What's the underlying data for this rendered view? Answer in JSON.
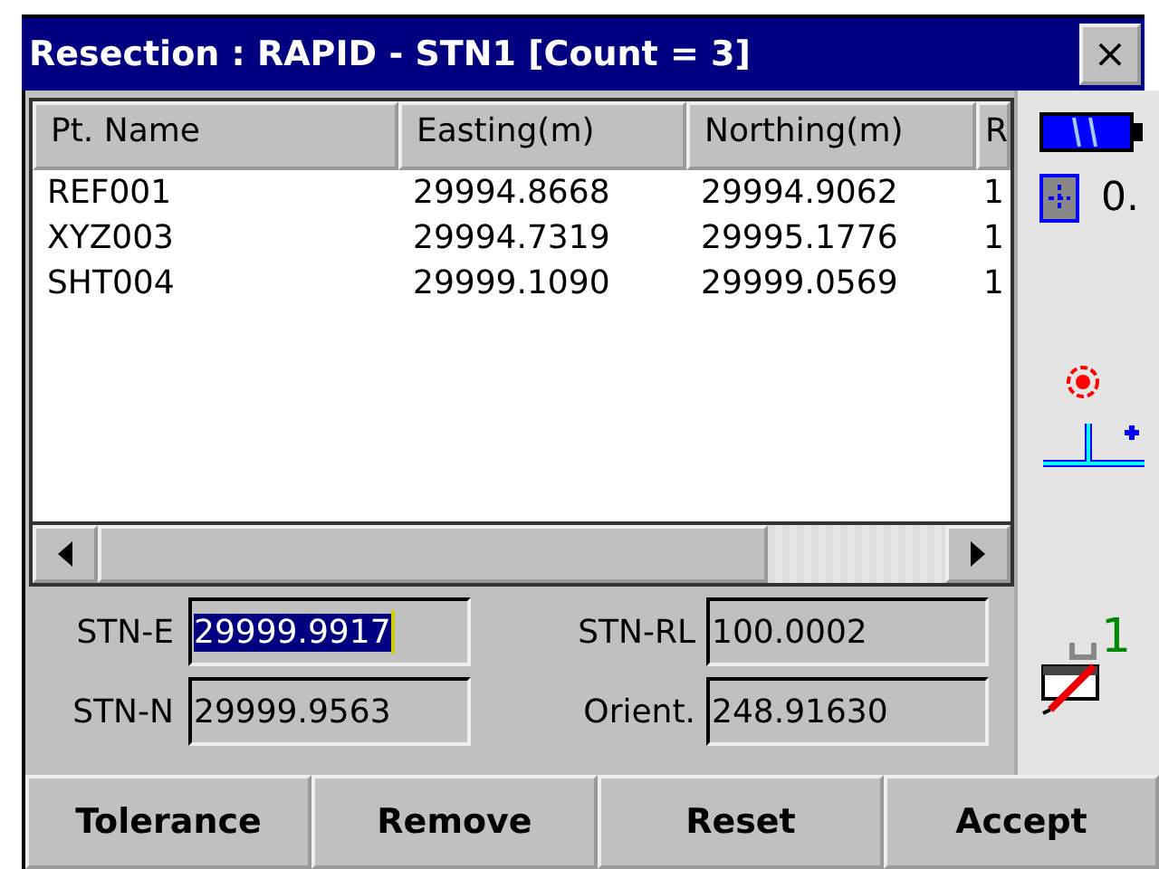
{
  "window": {
    "title": "Resection : RAPID - STN1 [Count = 3]",
    "close": "×"
  },
  "table": {
    "columns": [
      "Pt. Name",
      "Easting(m)",
      "Northing(m)",
      "R"
    ],
    "rows": [
      [
        "REF001",
        "29994.8668",
        "29994.9062",
        "1"
      ],
      [
        "XYZ003",
        "29994.7319",
        "29995.1776",
        "1"
      ],
      [
        "SHT004",
        "29999.1090",
        "29999.0569",
        "1"
      ]
    ]
  },
  "side_panel": {
    "reading": "0.",
    "count": "1"
  },
  "fields": [
    {
      "label": "STN-E",
      "value": "29999.9917",
      "selected": true
    },
    {
      "label": "STN-RL",
      "value": "100.0002",
      "selected": false
    },
    {
      "label": "STN-N",
      "value": "29999.9563",
      "selected": false
    },
    {
      "label": "Orient.",
      "value": "248.91630",
      "selected": false
    }
  ],
  "buttons": [
    "Tolerance",
    "Remove",
    "Reset",
    "Accept"
  ]
}
